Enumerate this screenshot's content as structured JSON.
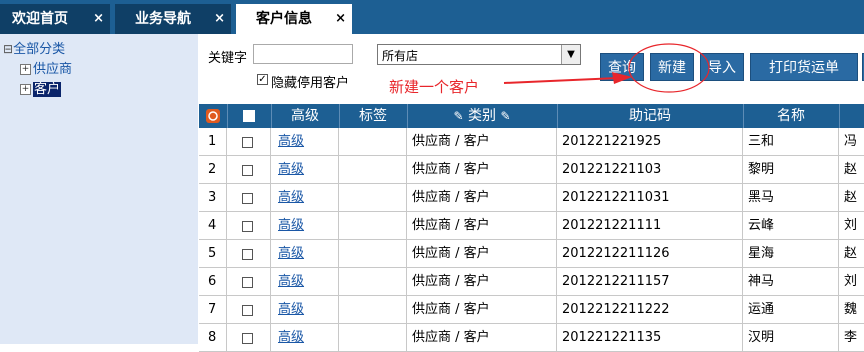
{
  "tabs": [
    {
      "label": "欢迎首页",
      "close": "×"
    },
    {
      "label": "业务导航",
      "close": "×"
    },
    {
      "label": "客户信息",
      "close": "×"
    }
  ],
  "tree": {
    "root": "全部分类",
    "children": [
      "供应商",
      "客户"
    ],
    "expand_glyph": "⊟",
    "child_glyph": "+"
  },
  "filters": {
    "keyword_label": "关键字",
    "keyword_value": "",
    "hide_disabled_label": "隐藏停用客户",
    "hide_disabled_checked": true,
    "store_select_value": "所有店"
  },
  "toolbar": {
    "query": "查询",
    "new": "新建",
    "import": "导入",
    "print": "打印货运单"
  },
  "annotation": {
    "text": "新建一个客户",
    "color": "#e8262b"
  },
  "table": {
    "headers": {
      "level": "高级",
      "tag": "标签",
      "category": "类别",
      "code": "助记码",
      "name": "名称"
    },
    "rows": [
      {
        "n": "1",
        "level": "高级",
        "tag": "",
        "category": "供应商 / 客户",
        "code": "201221221925",
        "name": "三和",
        "extra": "冯"
      },
      {
        "n": "2",
        "level": "高级",
        "tag": "",
        "category": "供应商 / 客户",
        "code": "201221221103",
        "name": "黎明",
        "extra": "赵"
      },
      {
        "n": "3",
        "level": "高级",
        "tag": "",
        "category": "供应商 / 客户",
        "code": "2012212211031",
        "name": "黑马",
        "extra": "赵"
      },
      {
        "n": "4",
        "level": "高级",
        "tag": "",
        "category": "供应商 / 客户",
        "code": "201221221111",
        "name": "云峰",
        "extra": "刘"
      },
      {
        "n": "5",
        "level": "高级",
        "tag": "",
        "category": "供应商 / 客户",
        "code": "2012212211126",
        "name": "星海",
        "extra": "赵"
      },
      {
        "n": "6",
        "level": "高级",
        "tag": "",
        "category": "供应商 / 客户",
        "code": "2012212211157",
        "name": "神马",
        "extra": "刘"
      },
      {
        "n": "7",
        "level": "高级",
        "tag": "",
        "category": "供应商 / 客户",
        "code": "2012212211222",
        "name": "运通",
        "extra": "魏"
      },
      {
        "n": "8",
        "level": "高级",
        "tag": "",
        "category": "供应商 / 客户",
        "code": "201221221135",
        "name": "汉明",
        "extra": "李"
      }
    ]
  },
  "colors": {
    "header_blue": "#1d5f93",
    "tab_dark": "#0f3f66",
    "tree_bg": "#dfe8f6",
    "link": "#1a57a6",
    "annotation_red": "#e8262b"
  }
}
